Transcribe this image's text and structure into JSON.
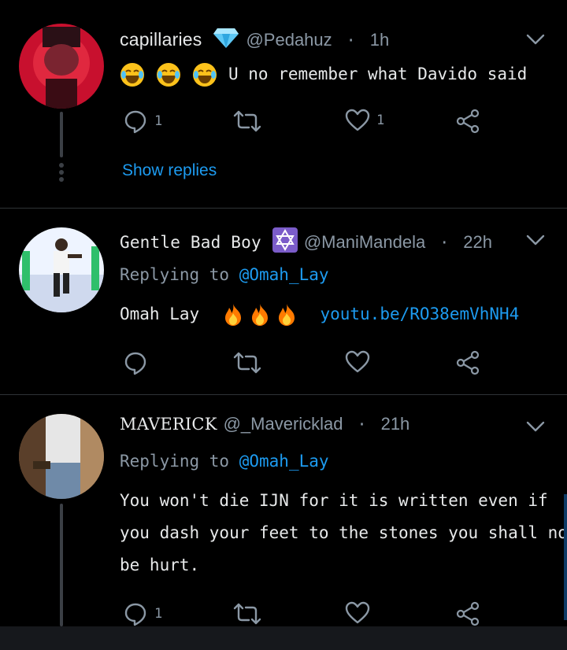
{
  "tweets": [
    {
      "name": "capillaries",
      "badge": "gem",
      "handle": "@Pedahuz",
      "separator": "·",
      "time": "1h",
      "text": "U no remember what Davido said",
      "emojis": [
        "😂",
        "😂",
        "😂"
      ],
      "reply_count": "1",
      "like_count": "1",
      "show_replies": "Show replies"
    },
    {
      "name": "Gentle Bad Boy",
      "badge": "star-of-david",
      "handle": "@ManiMandela",
      "separator": "·",
      "time": "22h",
      "replying_to_label": "Replying to",
      "replying_to": "@Omah_Lay",
      "text": "Omah Lay",
      "emojis": [
        "🔥",
        "🔥",
        "🔥"
      ],
      "link": "youtu.be/RO38emVhNH4"
    },
    {
      "name": "MAVERICK",
      "handle": "@_Mavericklad",
      "separator": "·",
      "time": "21h",
      "replying_to_label": "Replying to",
      "replying_to": "@Omah_Lay",
      "text_lines": [
        "You won't die IJN for it is written even if",
        "you dash your feet to the stones you shall not",
        "be hurt."
      ],
      "reply_count": "1"
    }
  ],
  "colors": {
    "background": "#000000",
    "text": "#e7e9ea",
    "muted": "#8b98a5",
    "accent": "#1d9bf0",
    "divider": "#2f3336"
  }
}
